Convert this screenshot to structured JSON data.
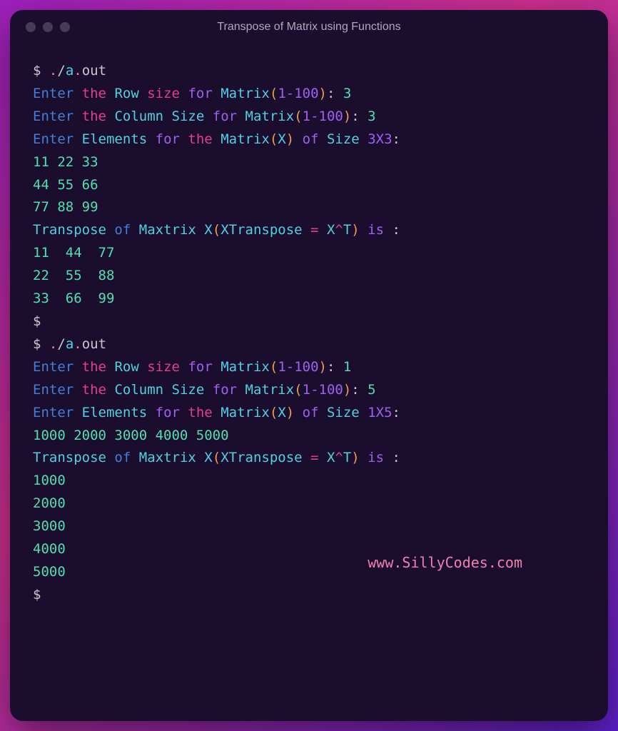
{
  "window": {
    "title": "Transpose of Matrix using Functions"
  },
  "prompt": "$",
  "cmd": {
    "dot": ".",
    "slash": "/",
    "a": "a",
    "dotOut": ".",
    "out": "out"
  },
  "run1": {
    "rowPrompt": {
      "enter": "Enter",
      "the": "the",
      "row": "Row",
      "size": "size",
      "for": "for",
      "matrix": "Matrix",
      "range": "1-100",
      "val": "3"
    },
    "colPrompt": {
      "enter": "Enter",
      "the": "the",
      "column": "Column",
      "size": "Size",
      "for": "for",
      "matrix": "Matrix",
      "range": "1-100",
      "val": "3"
    },
    "elemPrompt": {
      "enter": "Enter",
      "elements": "Elements",
      "for": "for",
      "the": "the",
      "matrix": "Matrix",
      "X": "X",
      "of": "of",
      "size": "Size",
      "dims": "3X3"
    },
    "inputRows": [
      "11 22 33",
      "44 55 66",
      "77 88 99"
    ],
    "transHead": {
      "transpose": "Transpose",
      "of": "of",
      "maxtrix": "Maxtrix",
      "X": "X",
      "xtrans": "XTranspose",
      "eq": "=",
      "xt": "X^T",
      "is": "is"
    },
    "outputRows": [
      "11  44  77",
      "22  55  88",
      "33  66  99"
    ]
  },
  "run2": {
    "rowPrompt": {
      "enter": "Enter",
      "the": "the",
      "row": "Row",
      "size": "size",
      "for": "for",
      "matrix": "Matrix",
      "range": "1-100",
      "val": "1"
    },
    "colPrompt": {
      "enter": "Enter",
      "the": "the",
      "column": "Column",
      "size": "Size",
      "for": "for",
      "matrix": "Matrix",
      "range": "1-100",
      "val": "5"
    },
    "elemPrompt": {
      "enter": "Enter",
      "elements": "Elements",
      "for": "for",
      "the": "the",
      "matrix": "Matrix",
      "X": "X",
      "of": "of",
      "size": "Size",
      "dims": "1X5"
    },
    "inputRows": [
      "1000 2000 3000 4000 5000"
    ],
    "transHead": {
      "transpose": "Transpose",
      "of": "of",
      "maxtrix": "Maxtrix",
      "X": "X",
      "xtrans": "XTranspose",
      "eq": "=",
      "xt": "X^T",
      "is": "is"
    },
    "outputRows": [
      "1000",
      "2000",
      "3000",
      "4000",
      "5000"
    ]
  },
  "watermark": "www.SillyCodes.com"
}
